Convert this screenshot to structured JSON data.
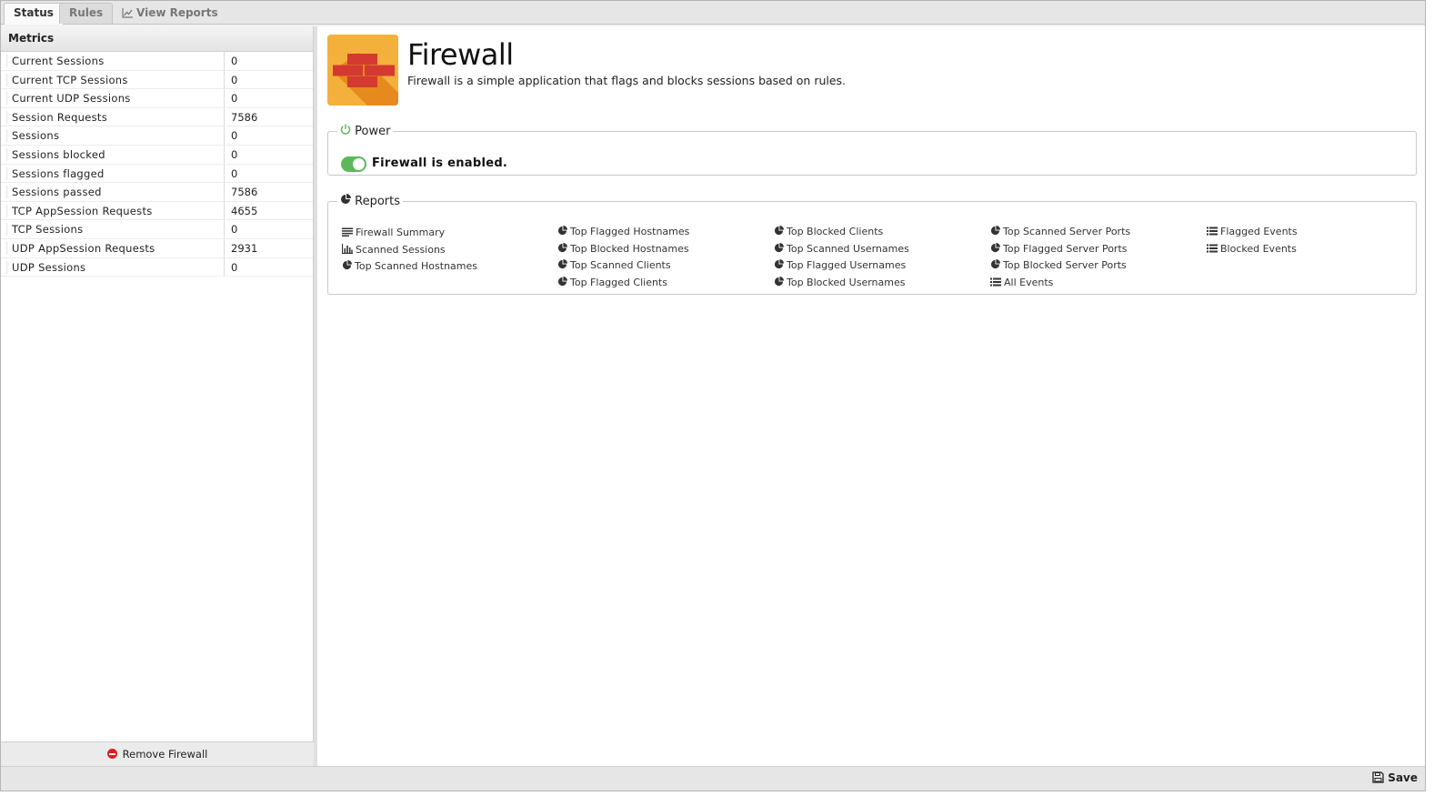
{
  "tabs": [
    {
      "label": "Status"
    },
    {
      "label": "Rules"
    },
    {
      "label": "View Reports"
    }
  ],
  "metrics": {
    "title": "Metrics",
    "rows": [
      {
        "name": "Current Sessions",
        "value": "0"
      },
      {
        "name": "Current TCP Sessions",
        "value": "0"
      },
      {
        "name": "Current UDP Sessions",
        "value": "0"
      },
      {
        "name": "Session Requests",
        "value": "7586"
      },
      {
        "name": "Sessions",
        "value": "0"
      },
      {
        "name": "Sessions blocked",
        "value": "0"
      },
      {
        "name": "Sessions flagged",
        "value": "0"
      },
      {
        "name": "Sessions passed",
        "value": "7586"
      },
      {
        "name": "TCP AppSession Requests",
        "value": "4655"
      },
      {
        "name": "TCP Sessions",
        "value": "0"
      },
      {
        "name": "UDP AppSession Requests",
        "value": "2931"
      },
      {
        "name": "UDP Sessions",
        "value": "0"
      }
    ],
    "remove_label": "Remove Firewall"
  },
  "app": {
    "name": "Firewall",
    "description": "Firewall is a simple application that flags and blocks sessions based on rules.",
    "icon": "brick-wall-icon"
  },
  "power": {
    "legend": "Power",
    "status_text": "Firewall is enabled.",
    "enabled": true,
    "accent_color": "#5cb85c"
  },
  "reports": {
    "legend": "Reports",
    "columns": [
      [
        {
          "label": "Firewall Summary",
          "icon": "text-icon"
        },
        {
          "label": "Scanned Sessions",
          "icon": "bar-chart-icon"
        },
        {
          "label": "Top Scanned Hostnames",
          "icon": "pie-chart-icon"
        }
      ],
      [
        {
          "label": "Top Flagged Hostnames",
          "icon": "pie-chart-icon"
        },
        {
          "label": "Top Blocked Hostnames",
          "icon": "pie-chart-icon"
        },
        {
          "label": "Top Scanned Clients",
          "icon": "pie-chart-icon"
        },
        {
          "label": "Top Flagged Clients",
          "icon": "pie-chart-icon"
        }
      ],
      [
        {
          "label": "Top Blocked Clients",
          "icon": "pie-chart-icon"
        },
        {
          "label": "Top Scanned Usernames",
          "icon": "pie-chart-icon"
        },
        {
          "label": "Top Flagged Usernames",
          "icon": "pie-chart-icon"
        },
        {
          "label": "Top Blocked Usernames",
          "icon": "pie-chart-icon"
        }
      ],
      [
        {
          "label": "Top Scanned Server Ports",
          "icon": "pie-chart-icon"
        },
        {
          "label": "Top Flagged Server Ports",
          "icon": "pie-chart-icon"
        },
        {
          "label": "Top Blocked Server Ports",
          "icon": "pie-chart-icon"
        },
        {
          "label": "All Events",
          "icon": "list-icon"
        }
      ],
      [
        {
          "label": "Flagged Events",
          "icon": "list-icon"
        },
        {
          "label": "Blocked Events",
          "icon": "list-icon"
        }
      ]
    ]
  },
  "footer": {
    "save_label": "Save"
  }
}
